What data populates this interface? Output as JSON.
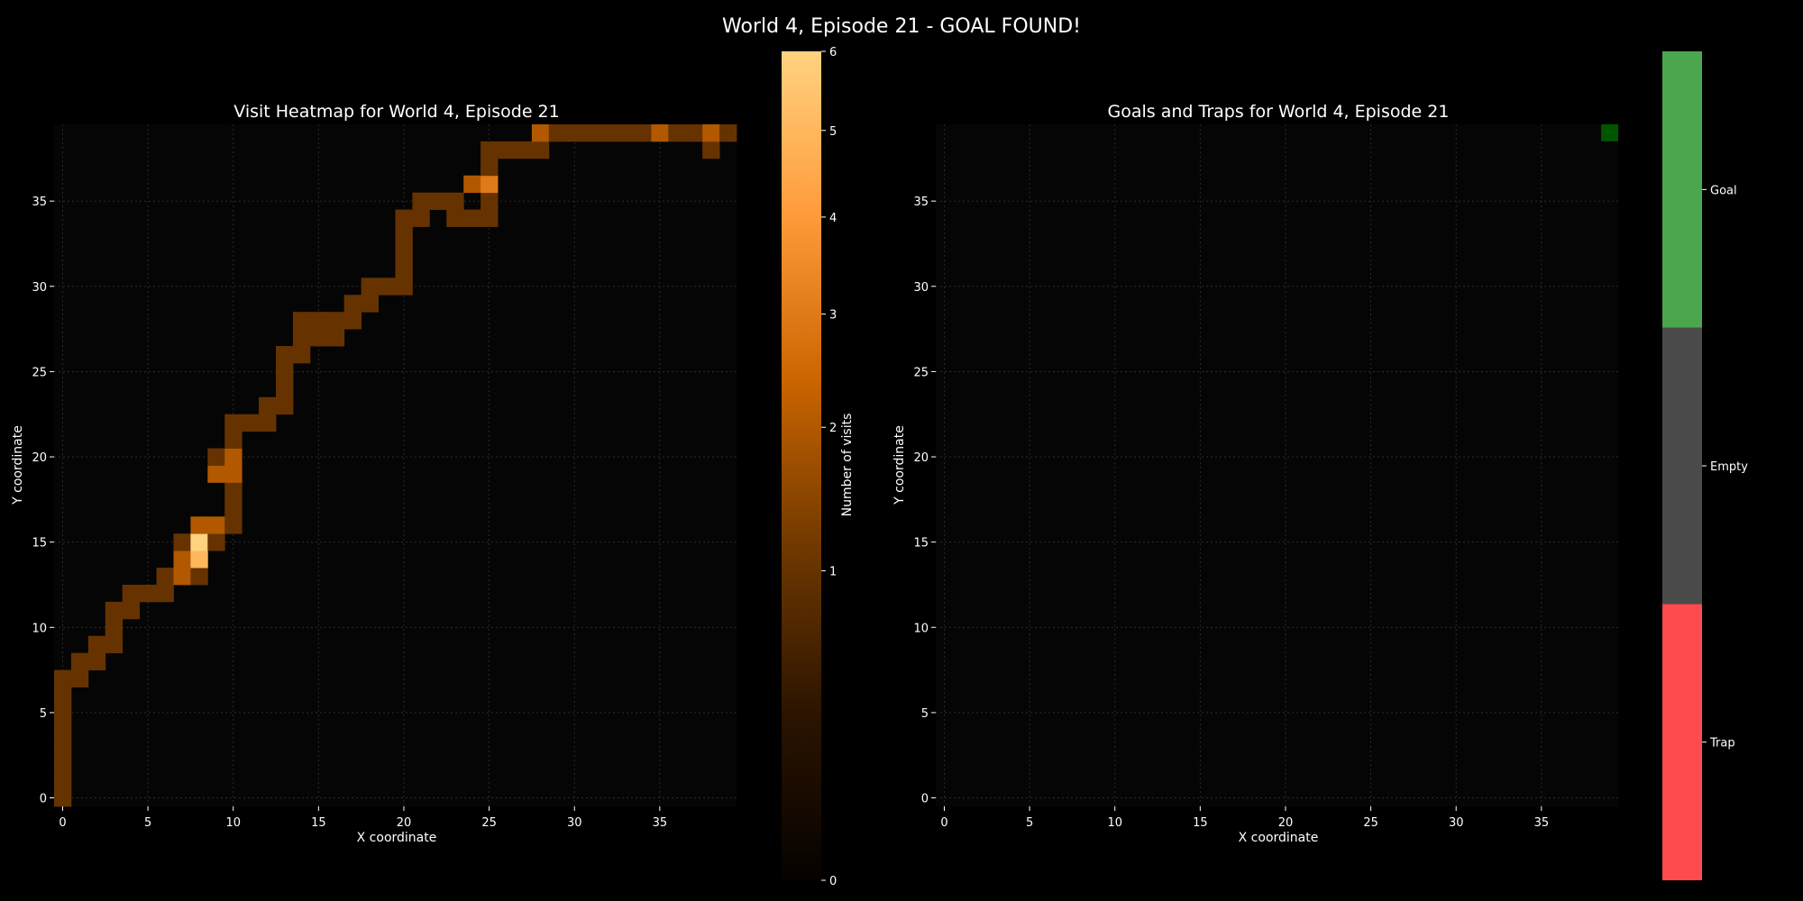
{
  "suptitle": "World 4, Episode 21 - GOAL FOUND!",
  "colors": {
    "background": "#000000",
    "plot_background": "#050505",
    "grid": "#333333",
    "goal": "#4aa74e",
    "empty": "#4b4b4b",
    "trap": "#ff4b4e",
    "goal_cell": "#005500",
    "heat_stops": [
      "#050200",
      "#2b1400",
      "#6f3800",
      "#c96400",
      "#ff9a3a",
      "#ffd27f"
    ]
  },
  "chart_data": [
    {
      "type": "heatmap",
      "title": "Visit Heatmap for World 4, Episode 21",
      "xlabel": "X coordinate",
      "ylabel": "Y coordinate",
      "xlim": [
        -0.5,
        39.5
      ],
      "ylim": [
        -0.5,
        39.5
      ],
      "xticks": [
        0,
        5,
        10,
        15,
        20,
        25,
        30,
        35
      ],
      "yticks": [
        0,
        5,
        10,
        15,
        20,
        25,
        30,
        35
      ],
      "grid": true,
      "colorbar": {
        "label": "Number of visits",
        "range": [
          0,
          6
        ],
        "ticks": [
          0,
          1,
          2,
          3,
          4,
          5,
          6
        ],
        "scale": "power"
      },
      "cells": [
        [
          0,
          0,
          1
        ],
        [
          0,
          1,
          1
        ],
        [
          0,
          2,
          1
        ],
        [
          0,
          3,
          1
        ],
        [
          0,
          4,
          1
        ],
        [
          0,
          5,
          1
        ],
        [
          0,
          6,
          1
        ],
        [
          0,
          7,
          1
        ],
        [
          1,
          7,
          1
        ],
        [
          1,
          8,
          1
        ],
        [
          2,
          8,
          1
        ],
        [
          2,
          9,
          1
        ],
        [
          3,
          9,
          1
        ],
        [
          3,
          10,
          1
        ],
        [
          3,
          11,
          1
        ],
        [
          4,
          11,
          1
        ],
        [
          4,
          12,
          1
        ],
        [
          5,
          12,
          1
        ],
        [
          6,
          12,
          1
        ],
        [
          6,
          13,
          1
        ],
        [
          7,
          13,
          2
        ],
        [
          7,
          14,
          2
        ],
        [
          7,
          15,
          1
        ],
        [
          8,
          13,
          1
        ],
        [
          8,
          14,
          5
        ],
        [
          8,
          15,
          6
        ],
        [
          8,
          16,
          2
        ],
        [
          9,
          15,
          1
        ],
        [
          9,
          16,
          2
        ],
        [
          9,
          19,
          2
        ],
        [
          9,
          20,
          1
        ],
        [
          10,
          16,
          1
        ],
        [
          10,
          17,
          1
        ],
        [
          10,
          18,
          1
        ],
        [
          10,
          19,
          2
        ],
        [
          10,
          20,
          2
        ],
        [
          10,
          21,
          1
        ],
        [
          10,
          22,
          1
        ],
        [
          11,
          22,
          1
        ],
        [
          12,
          22,
          1
        ],
        [
          12,
          23,
          1
        ],
        [
          13,
          23,
          1
        ],
        [
          13,
          24,
          1
        ],
        [
          13,
          25,
          1
        ],
        [
          13,
          26,
          1
        ],
        [
          14,
          26,
          1
        ],
        [
          14,
          27,
          1
        ],
        [
          14,
          28,
          1
        ],
        [
          15,
          27,
          1
        ],
        [
          15,
          28,
          1
        ],
        [
          16,
          27,
          1
        ],
        [
          16,
          28,
          1
        ],
        [
          17,
          28,
          1
        ],
        [
          17,
          29,
          1
        ],
        [
          18,
          29,
          1
        ],
        [
          18,
          30,
          1
        ],
        [
          19,
          30,
          1
        ],
        [
          20,
          30,
          1
        ],
        [
          20,
          31,
          1
        ],
        [
          20,
          32,
          1
        ],
        [
          20,
          33,
          1
        ],
        [
          20,
          34,
          1
        ],
        [
          21,
          34,
          1
        ],
        [
          21,
          35,
          1
        ],
        [
          22,
          35,
          1
        ],
        [
          23,
          34,
          1
        ],
        [
          23,
          35,
          1
        ],
        [
          24,
          34,
          1
        ],
        [
          24,
          36,
          2
        ],
        [
          25,
          34,
          1
        ],
        [
          25,
          35,
          1
        ],
        [
          25,
          36,
          3
        ],
        [
          25,
          37,
          1
        ],
        [
          25,
          38,
          1
        ],
        [
          26,
          38,
          1
        ],
        [
          27,
          38,
          1
        ],
        [
          28,
          38,
          1
        ],
        [
          28,
          39,
          2
        ],
        [
          29,
          39,
          1
        ],
        [
          30,
          39,
          1
        ],
        [
          31,
          39,
          1
        ],
        [
          32,
          39,
          1
        ],
        [
          33,
          39,
          1
        ],
        [
          34,
          39,
          1
        ],
        [
          35,
          39,
          2
        ],
        [
          36,
          39,
          1
        ],
        [
          37,
          39,
          1
        ],
        [
          38,
          38,
          1
        ],
        [
          38,
          39,
          2
        ],
        [
          39,
          39,
          1
        ]
      ]
    },
    {
      "type": "heatmap",
      "title": "Goals and Traps for World 4, Episode 21",
      "xlabel": "X coordinate",
      "ylabel": "Y coordinate",
      "xlim": [
        -0.5,
        39.5
      ],
      "ylim": [
        -0.5,
        39.5
      ],
      "xticks": [
        0,
        5,
        10,
        15,
        20,
        25,
        30,
        35
      ],
      "yticks": [
        0,
        5,
        10,
        15,
        20,
        25,
        30,
        35
      ],
      "grid": true,
      "cells": [
        {
          "x": 39,
          "y": 39,
          "kind": "goal"
        }
      ],
      "colorbar": {
        "categories": [
          "Trap",
          "Empty",
          "Goal"
        ]
      }
    }
  ]
}
